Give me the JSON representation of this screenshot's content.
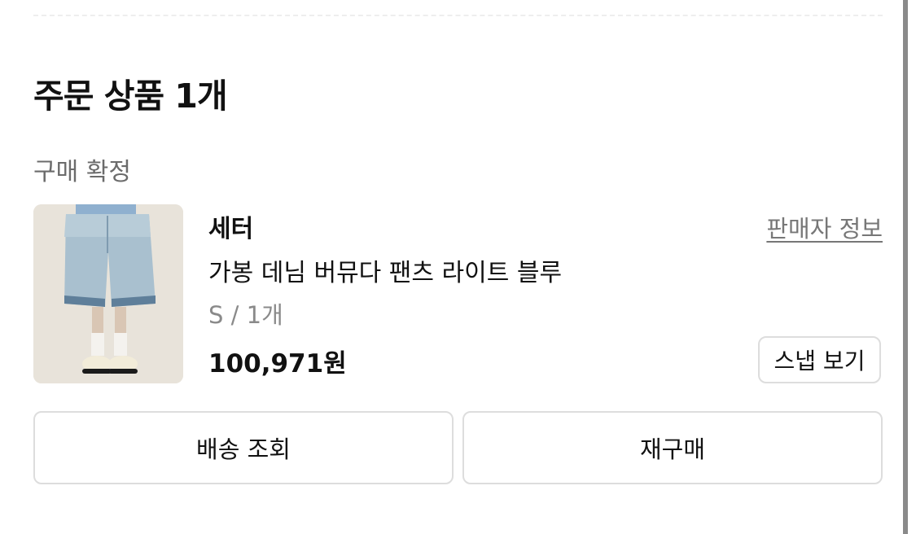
{
  "order": {
    "title": "주문 상품 1개",
    "status": "구매 확정"
  },
  "product": {
    "image_icon": "product-photo-denim-shorts",
    "brand": "세터",
    "seller_link": "판매자 정보",
    "name": "가봉 데님 버뮤다 팬츠 라이트 블루",
    "option": "S / 1개",
    "price": "100,971원",
    "snap_button": "스냅 보기"
  },
  "actions": {
    "track_label": "배송 조회",
    "rebuy_label": "재구매"
  },
  "colors": {
    "title": "#111111",
    "muted": "#6b6b6b",
    "border": "#dddddd",
    "denim": "#9fb8c9"
  }
}
